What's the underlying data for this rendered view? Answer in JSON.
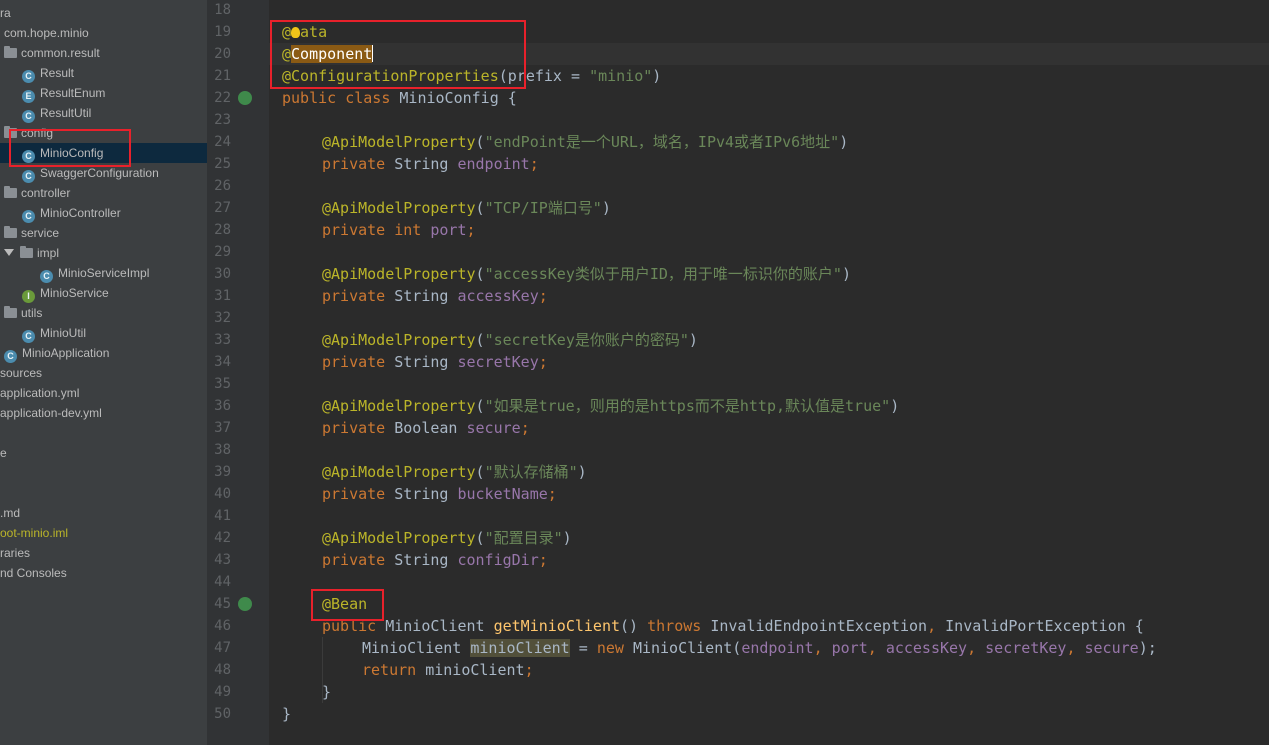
{
  "project_tree": [
    {
      "label": "ra",
      "kind": "text",
      "indent": 0
    },
    {
      "label": "com.hope.minio",
      "kind": "text",
      "indent": 1
    },
    {
      "label": "common.result",
      "kind": "folder",
      "indent": 1
    },
    {
      "label": "Result",
      "kind": "class",
      "icon": "C",
      "indent": 2
    },
    {
      "label": "ResultEnum",
      "kind": "class",
      "icon": "E",
      "indent": 2
    },
    {
      "label": "ResultUtil",
      "kind": "class",
      "icon": "C",
      "indent": 2
    },
    {
      "label": "config",
      "kind": "folder",
      "indent": 1
    },
    {
      "label": "MinioConfig",
      "kind": "class",
      "icon": "C",
      "indent": 2,
      "selected": true
    },
    {
      "label": "SwaggerConfiguration",
      "kind": "class",
      "icon": "C",
      "indent": 2
    },
    {
      "label": "controller",
      "kind": "folder",
      "indent": 1
    },
    {
      "label": "MinioController",
      "kind": "class",
      "icon": "C",
      "indent": 2
    },
    {
      "label": "service",
      "kind": "folder",
      "indent": 1
    },
    {
      "label": "impl",
      "kind": "folder-open",
      "indent": 1
    },
    {
      "label": "MinioServiceImpl",
      "kind": "class",
      "icon": "C",
      "indent": 3
    },
    {
      "label": "MinioService",
      "kind": "interface",
      "icon": "I",
      "indent": 2
    },
    {
      "label": "utils",
      "kind": "folder",
      "indent": 1
    },
    {
      "label": "MinioUtil",
      "kind": "class",
      "icon": "C",
      "indent": 2
    },
    {
      "label": "MinioApplication",
      "kind": "class",
      "icon": "C",
      "indent": 1
    },
    {
      "label": "sources",
      "kind": "text",
      "indent": 0
    },
    {
      "label": "application.yml",
      "kind": "text",
      "indent": 0
    },
    {
      "label": "application-dev.yml",
      "kind": "text",
      "indent": 0
    },
    {
      "label": "",
      "kind": "text",
      "indent": 0
    },
    {
      "label": "e",
      "kind": "text",
      "indent": 0
    },
    {
      "label": "",
      "kind": "text",
      "indent": 0
    },
    {
      "label": "",
      "kind": "text",
      "indent": 0
    },
    {
      "label": ".md",
      "kind": "text",
      "indent": 0
    },
    {
      "label": "oot-minio.iml",
      "kind": "text",
      "indent": 0,
      "color": "#bbb529"
    },
    {
      "label": "raries",
      "kind": "text",
      "indent": 0
    },
    {
      "label": "nd Consoles",
      "kind": "text",
      "indent": 0
    }
  ],
  "line_numbers": [
    "18",
    "19",
    "20",
    "21",
    "22",
    "23",
    "24",
    "25",
    "26",
    "27",
    "28",
    "29",
    "30",
    "31",
    "32",
    "33",
    "34",
    "35",
    "36",
    "37",
    "38",
    "39",
    "40",
    "41",
    "42",
    "43",
    "44",
    "45",
    "46",
    "47",
    "48",
    "49",
    "50"
  ],
  "code": {
    "l19_at": "@",
    "l19_rest": "ata",
    "l20_at": "@",
    "l20_rest": "Component",
    "l21_anno": "@ConfigurationProperties",
    "l21_a": "(prefix = ",
    "l21_s": "\"minio\"",
    "l21_b": ")",
    "l22_kw": "public class ",
    "l22_name": "MinioConfig",
    "l22_brace": " {",
    "l24_anno": "@ApiModelProperty",
    "l24_a": "(",
    "l24_s": "\"endPoint是一个URL，域名，IPv4或者IPv6地址\"",
    "l24_b": ")",
    "l25_kw": "private ",
    "l25_type": "String ",
    "l25_field": "endpoint",
    "l25_end": ";",
    "l27_anno": "@ApiModelProperty",
    "l27_s": "\"TCP/IP端口号\"",
    "l28_kw": "private ",
    "l28_type": "int ",
    "l28_field": "port",
    "l30_anno": "@ApiModelProperty",
    "l30_s": "\"accessKey类似于用户ID，用于唯一标识你的账户\"",
    "l31_kw": "private ",
    "l31_type": "String ",
    "l31_field": "accessKey",
    "l33_anno": "@ApiModelProperty",
    "l33_s": "\"secretKey是你账户的密码\"",
    "l34_kw": "private ",
    "l34_type": "String ",
    "l34_field": "secretKey",
    "l36_anno": "@ApiModelProperty",
    "l36_s": "\"如果是true，则用的是https而不是http,默认值是true\"",
    "l37_kw": "private ",
    "l37_type": "Boolean ",
    "l37_field": "secure",
    "l39_anno": "@ApiModelProperty",
    "l39_s": "\"默认存储桶\"",
    "l40_kw": "private ",
    "l40_type": "String ",
    "l40_field": "bucketName",
    "l42_anno": "@ApiModelProperty",
    "l42_s": "\"配置目录\"",
    "l43_kw": "private ",
    "l43_type": "String ",
    "l43_field": "configDir",
    "l45_anno": "@Bean",
    "l46_kw": "public ",
    "l46_type": "MinioClient ",
    "l46_method": "getMinioClient",
    "l46_paren": "() ",
    "l46_throws": "throws ",
    "l46_ex1": "InvalidEndpointException",
    "l46_comma": ", ",
    "l46_ex2": "InvalidPortException",
    "l46_brace": " {",
    "l47_type": "MinioClient ",
    "l47_var": "minioClient",
    "l47_eq": " = ",
    "l47_new": "new ",
    "l47_ctor": "MinioClient(",
    "l47_f1": "endpoint",
    "l47_f2": "port",
    "l47_f3": "accessKey",
    "l47_f4": "secretKey",
    "l47_f5": "secure",
    "l47_sep": ", ",
    "l47_end": ");",
    "l48_kw": "return ",
    "l48_var": "minioClient",
    "l48_end": ";",
    "l49": "}",
    "l50": "}"
  },
  "colors": {
    "keyword": "#cc7832",
    "annotation": "#bbb529",
    "string": "#6a8759",
    "field": "#9876aa",
    "highlight": "#e8212b"
  }
}
